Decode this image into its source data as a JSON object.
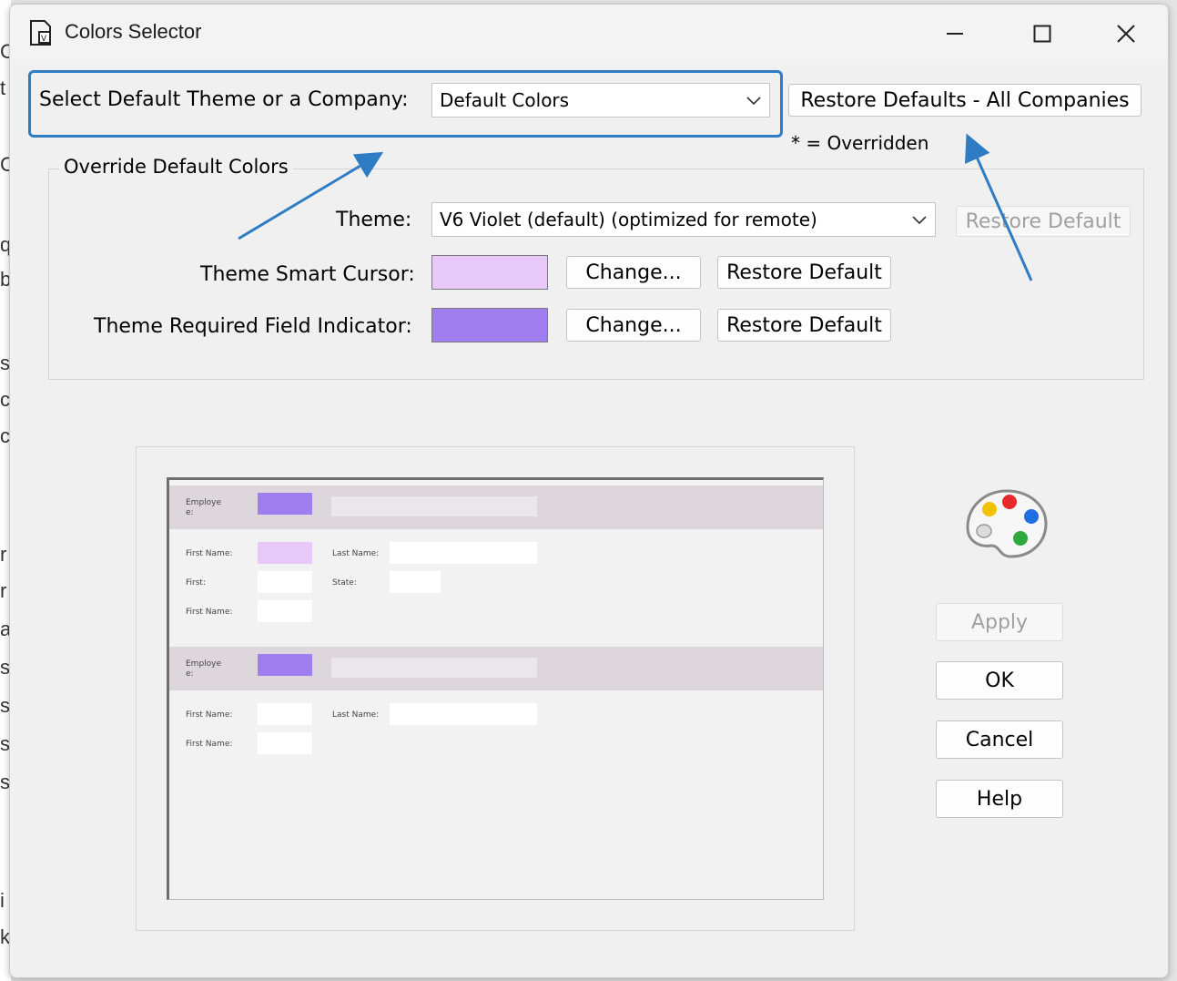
{
  "window": {
    "title": "Colors Selector"
  },
  "company": {
    "label": "Select Default Theme or a Company:",
    "value": "Default Colors",
    "restore_all_label": "Restore Defaults - All Companies",
    "overridden_note": "* = Overridden"
  },
  "override": {
    "group_title": "Override Default Colors",
    "theme_label": "Theme:",
    "theme_value": "V6 Violet (default) (optimized for remote)",
    "theme_restore_label": "Restore Default",
    "smart_cursor_label": "Theme Smart Cursor:",
    "smart_cursor_color": "#e8c8f8",
    "required_label": "Theme Required Field Indicator:",
    "required_color": "#a07ef0",
    "change_label": "Change...",
    "restore_label": "Restore Default"
  },
  "preview": {
    "employee_label_1": "Employe",
    "employee_label_2": "e:",
    "first_name": "First Name:",
    "last_name": "Last Name:",
    "first": "First:",
    "state": "State:"
  },
  "actions": {
    "apply": "Apply",
    "ok": "OK",
    "cancel": "Cancel",
    "help": "Help"
  },
  "colors": {
    "accent_highlight": "#2e7dc4",
    "band": "#ddd6dd"
  }
}
